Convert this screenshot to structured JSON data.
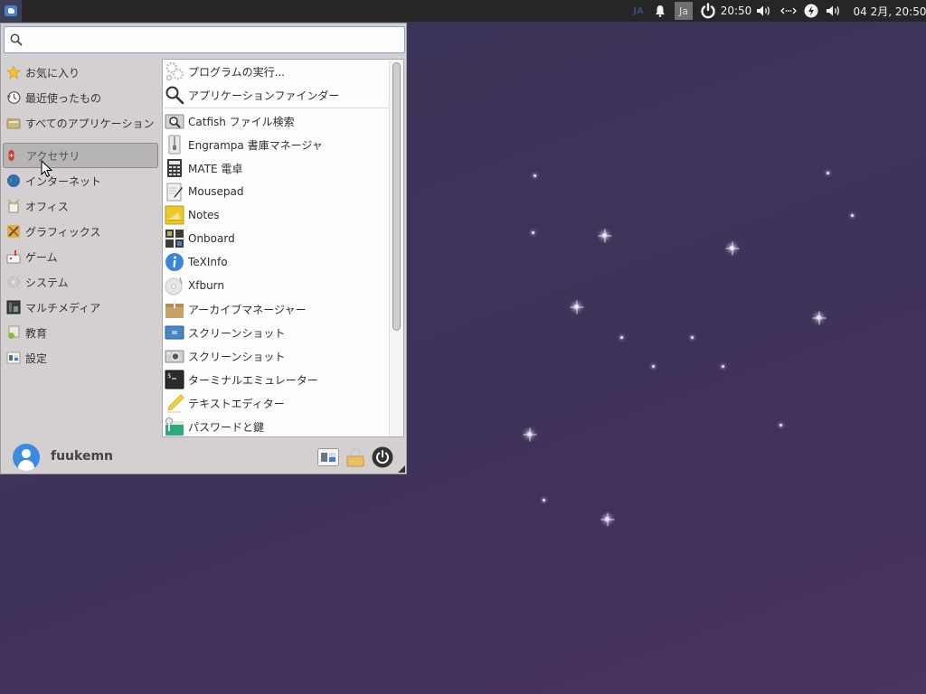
{
  "panel": {
    "kbd_layout": "JA",
    "ime_label": "Ja",
    "clock": "20:50",
    "date_time": "04 2月, 20:50",
    "icons": [
      "notification-bell-icon",
      "power-icon",
      "volume-icon",
      "network-icon",
      "power-manager-icon",
      "volume-icon"
    ]
  },
  "menu": {
    "search": {
      "value": "",
      "placeholder": ""
    },
    "categories": [
      {
        "label": "お気に入り",
        "icon": "star-icon"
      },
      {
        "label": "最近使ったもの",
        "icon": "recent-clock-icon"
      },
      {
        "label": "すべてのアプリケーション",
        "icon": "folder-icon"
      },
      {
        "label": "アクセサリ",
        "icon": "accessories-knife-icon",
        "selected": true
      },
      {
        "label": "インターネット",
        "icon": "globe-icon"
      },
      {
        "label": "オフィス",
        "icon": "office-icon"
      },
      {
        "label": "グラフィックス",
        "icon": "graphics-icon"
      },
      {
        "label": "ゲーム",
        "icon": "games-icon"
      },
      {
        "label": "システム",
        "icon": "system-gear-icon"
      },
      {
        "label": "マルチメディア",
        "icon": "multimedia-icon"
      },
      {
        "label": "教育",
        "icon": "education-icon"
      },
      {
        "label": "設定",
        "icon": "settings-icon"
      }
    ],
    "actions": [
      {
        "label": "プログラムの実行...",
        "icon": "run-program-gears-icon"
      },
      {
        "label": "アプリケーションファインダー",
        "icon": "magnifier-icon"
      }
    ],
    "apps": [
      {
        "label": "Catfish ファイル検索",
        "icon": "catfish-search-icon"
      },
      {
        "label": "Engrampa 書庫マネージャ",
        "icon": "archive-zipper-icon"
      },
      {
        "label": "MATE 電卓",
        "icon": "calculator-icon"
      },
      {
        "label": "Mousepad",
        "icon": "text-editor-pen-icon"
      },
      {
        "label": "Notes",
        "icon": "notes-icon"
      },
      {
        "label": "Onboard",
        "icon": "onboard-keyboard-icon"
      },
      {
        "label": "TeXInfo",
        "icon": "info-icon"
      },
      {
        "label": "Xfburn",
        "icon": "disc-burner-icon"
      },
      {
        "label": "アーカイブマネージャー",
        "icon": "archive-box-icon"
      },
      {
        "label": "スクリーンショット",
        "icon": "screenshot-monitor-icon"
      },
      {
        "label": "スクリーンショット",
        "icon": "camera-icon"
      },
      {
        "label": "ターミナルエミュレーター",
        "icon": "terminal-icon"
      },
      {
        "label": "テキストエディター",
        "icon": "pencil-icon"
      },
      {
        "label": "パスワードと鍵",
        "icon": "passwords-keys-icon"
      }
    ],
    "scroll_position": 0,
    "user": {
      "name": "fuukemn"
    },
    "footer_buttons": [
      "settings-manager-icon",
      "lock-screen-icon",
      "logout-power-icon"
    ]
  }
}
